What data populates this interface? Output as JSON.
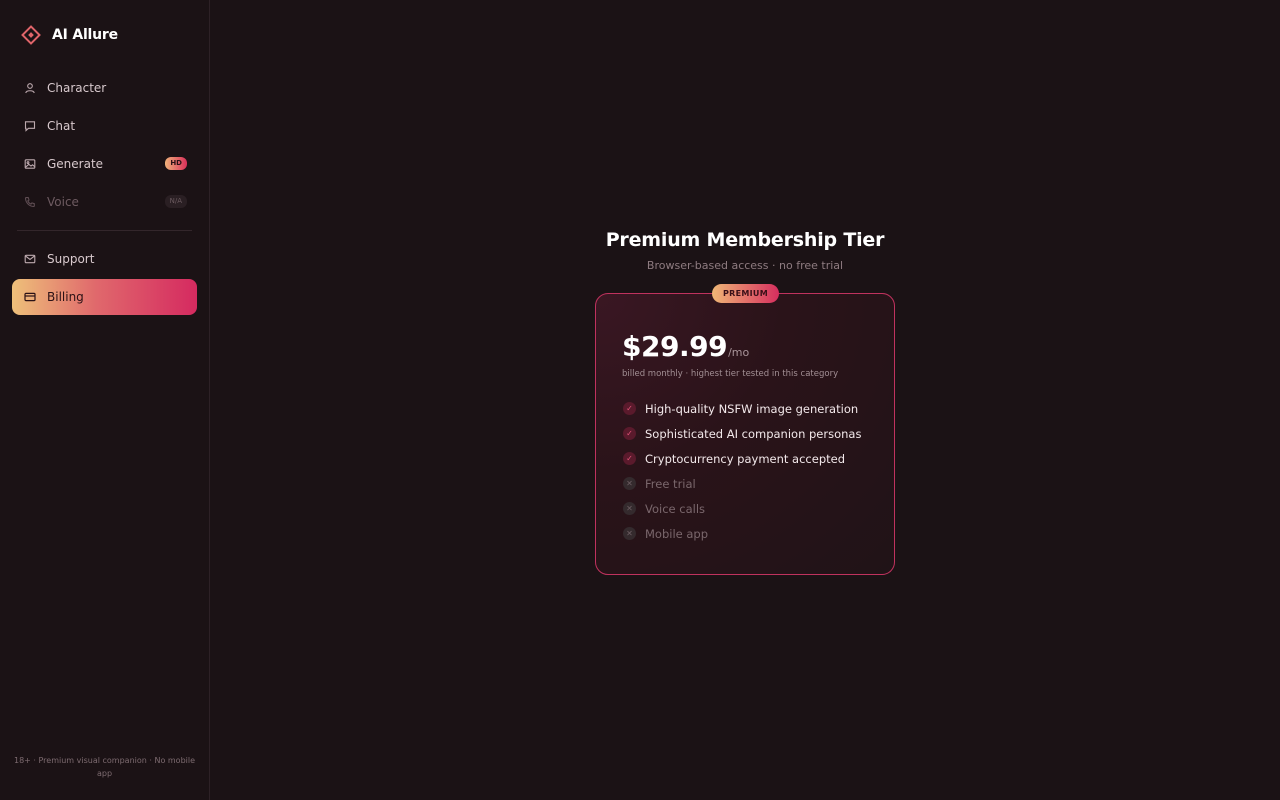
{
  "brand": {
    "name": "AI Allure"
  },
  "sidebar": {
    "items": [
      {
        "label": "Character",
        "icon": "user-icon"
      },
      {
        "label": "Chat",
        "icon": "message-icon"
      },
      {
        "label": "Generate",
        "icon": "image-icon",
        "badge": "HD"
      },
      {
        "label": "Voice",
        "icon": "phone-icon",
        "badge": "N/A",
        "disabled": true
      }
    ],
    "secondary": [
      {
        "label": "Support",
        "icon": "mail-icon"
      },
      {
        "label": "Billing",
        "icon": "credit-card-icon",
        "active": true
      }
    ],
    "footer": "18+ · Premium visual companion · No mobile app"
  },
  "main": {
    "title": "Premium Membership Tier",
    "subtitle": "Browser-based access · no free trial",
    "card": {
      "badge": "PREMIUM",
      "price": "$29.99",
      "period": "/mo",
      "note": "billed monthly · highest tier tested in this category",
      "features": [
        {
          "label": "High-quality NSFW image generation",
          "included": true
        },
        {
          "label": "Sophisticated AI companion personas",
          "included": true
        },
        {
          "label": "Cryptocurrency payment accepted",
          "included": true
        },
        {
          "label": "Free trial",
          "included": false
        },
        {
          "label": "Voice calls",
          "included": false
        },
        {
          "label": "Mobile app",
          "included": false
        }
      ]
    }
  },
  "colors": {
    "background": "#1b1215",
    "accent_start": "#eec07a",
    "accent_end": "#d52a60",
    "card_border": "#c0325e"
  }
}
